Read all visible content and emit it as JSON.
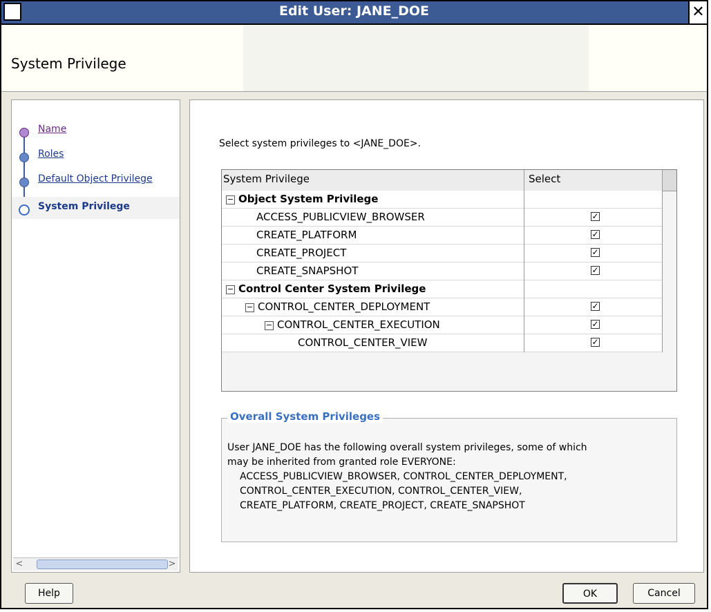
{
  "window": {
    "title": "Edit User: JANE_DOE",
    "close_glyph": "✕"
  },
  "header": {
    "title": "System Privilege"
  },
  "nav": {
    "items": [
      {
        "label": "Name",
        "state": "visited"
      },
      {
        "label": "Roles",
        "state": "normal"
      },
      {
        "label": "Default Object Privilege",
        "state": "normal"
      },
      {
        "label": "System Privilege",
        "state": "current"
      }
    ]
  },
  "content": {
    "instruction": "Select system privileges to <JANE_DOE>.",
    "table": {
      "col_privilege": "System Privilege",
      "col_select": "Select",
      "rows": [
        {
          "label": "Object System Privilege",
          "group": true,
          "checked": false
        },
        {
          "label": "ACCESS_PUBLICVIEW_BROWSER",
          "group": false,
          "checked": true
        },
        {
          "label": "CREATE_PLATFORM",
          "group": false,
          "checked": true
        },
        {
          "label": "CREATE_PROJECT",
          "group": false,
          "checked": true
        },
        {
          "label": "CREATE_SNAPSHOT",
          "group": false,
          "checked": true
        },
        {
          "label": "Control Center System Privilege",
          "group": true,
          "checked": false
        },
        {
          "label": "CONTROL_CENTER_DEPLOYMENT",
          "group": false,
          "checked": true
        },
        {
          "label": "CONTROL_CENTER_EXECUTION",
          "group": false,
          "checked": true
        },
        {
          "label": "CONTROL_CENTER_VIEW",
          "group": false,
          "checked": true
        }
      ]
    },
    "overall": {
      "legend": "Overall System Privileges",
      "line1": "User JANE_DOE has the following overall system privileges, some of which",
      "line2": "may be inherited from granted role EVERYONE:",
      "line3": "ACCESS_PUBLICVIEW_BROWSER, CONTROL_CENTER_DEPLOYMENT,",
      "line4": "CONTROL_CENTER_EXECUTION,  CONTROL_CENTER_VIEW,",
      "line5": "CREATE_PLATFORM,  CREATE_PROJECT, CREATE_SNAPSHOT"
    }
  },
  "buttons": {
    "help": "Help",
    "ok": "OK",
    "cancel": "Cancel"
  },
  "colors": {
    "titlebar": "#3c5b95",
    "legend": "#3a70c0",
    "link": "#1c3a8a"
  }
}
